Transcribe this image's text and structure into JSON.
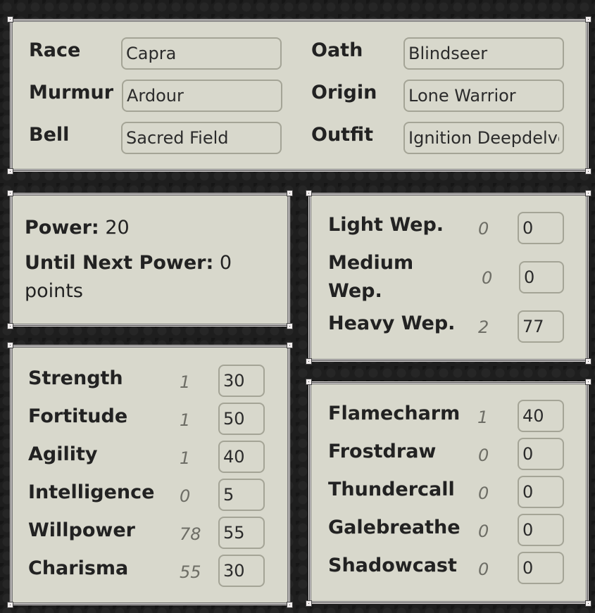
{
  "identity": {
    "left": [
      {
        "label": "Race",
        "value": "Capra"
      },
      {
        "label": "Murmur",
        "value": "Ardour"
      },
      {
        "label": "Bell",
        "value": "Sacred Field"
      }
    ],
    "right": [
      {
        "label": "Oath",
        "value": "Blindseer"
      },
      {
        "label": "Origin",
        "value": "Lone Warrior"
      },
      {
        "label": "Outfit",
        "value": "Ignition Deepdelver"
      }
    ]
  },
  "power": {
    "power_label": "Power:",
    "power_value": "20",
    "next_label": "Until Next Power:",
    "next_value": "0",
    "next_unit": "points"
  },
  "weapons": [
    {
      "label": "Light Wep.",
      "modifier": "0",
      "value": "0"
    },
    {
      "label_line1": "Medium",
      "label_line2": "Wep.",
      "modifier": "0",
      "value": "0"
    },
    {
      "label": "Heavy Wep.",
      "modifier": "2",
      "value": "77"
    }
  ],
  "attributes": [
    {
      "label": "Strength",
      "modifier": "1",
      "value": "30"
    },
    {
      "label": "Fortitude",
      "modifier": "1",
      "value": "50"
    },
    {
      "label": "Agility",
      "modifier": "1",
      "value": "40"
    },
    {
      "label": "Intelligence",
      "modifier": "0",
      "value": "5"
    },
    {
      "label": "Willpower",
      "modifier": "78",
      "value": "55"
    },
    {
      "label": "Charisma",
      "modifier": "55",
      "value": "30"
    }
  ],
  "attunements": [
    {
      "label": "Flamecharm",
      "modifier": "1",
      "value": "40"
    },
    {
      "label": "Frostdraw",
      "modifier": "0",
      "value": "0"
    },
    {
      "label": "Thundercall",
      "modifier": "0",
      "value": "0"
    },
    {
      "label": "Galebreathe",
      "modifier": "0",
      "value": "0"
    },
    {
      "label": "Shadowcast",
      "modifier": "0",
      "value": "0"
    }
  ]
}
